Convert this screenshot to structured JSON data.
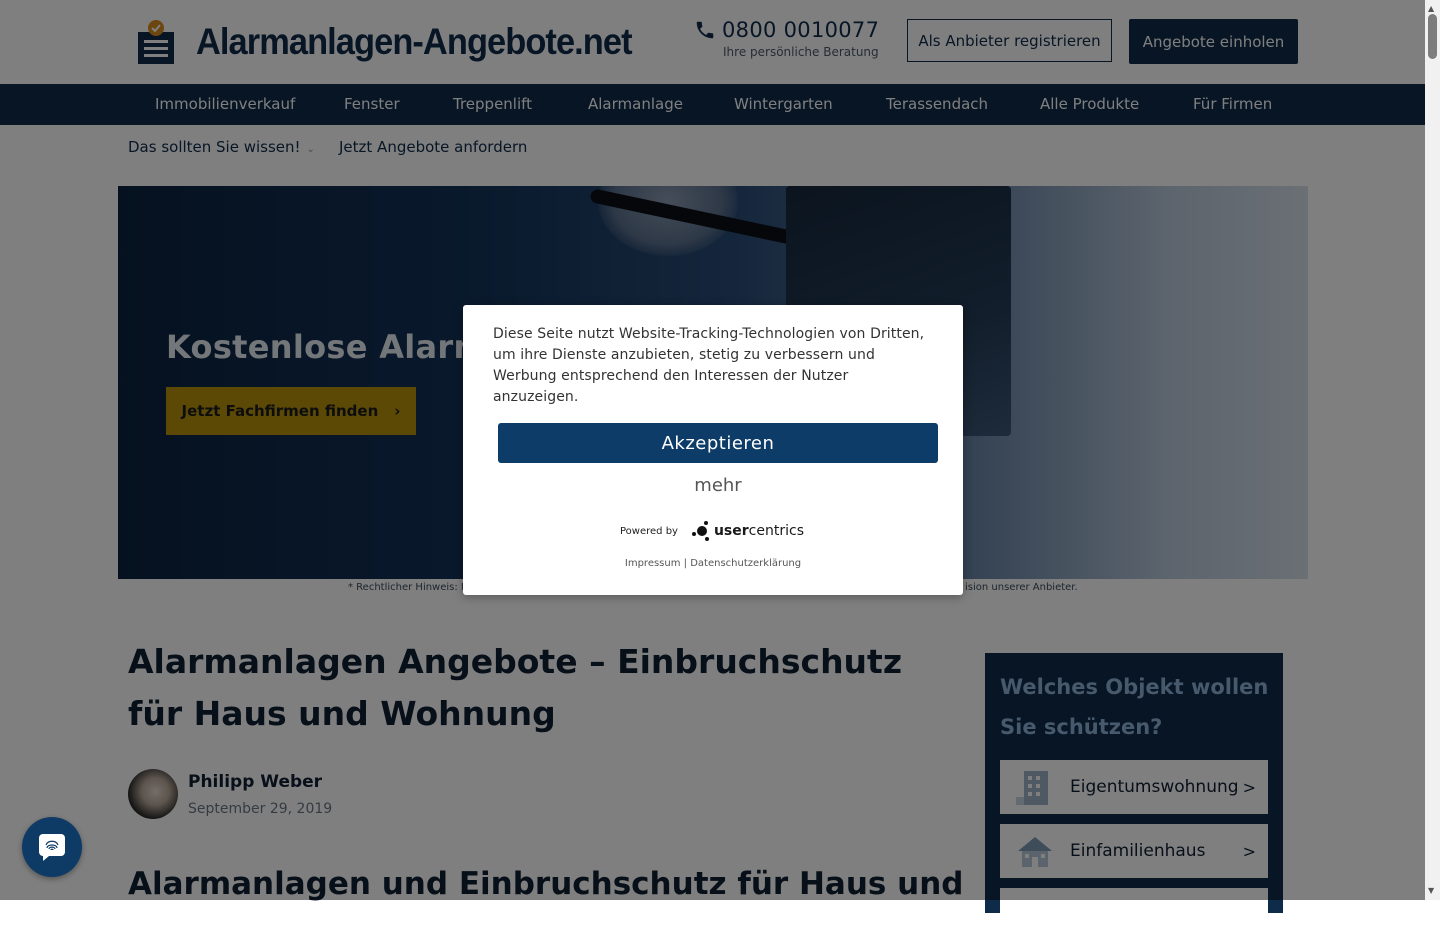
{
  "header": {
    "logo_text": "Alarmanlagen-Angebote.net",
    "phone_number": "0800 0010077",
    "phone_sub": "Ihre persönliche Beratung",
    "register_label": "Als Anbieter registrieren",
    "offers_label": "Angebote einholen"
  },
  "nav": {
    "items": [
      "Immobilienverkauf",
      "Fenster",
      "Treppenlift",
      "Alarmanlage",
      "Wintergarten",
      "Terassendach",
      "Alle Produkte",
      "Für Firmen"
    ]
  },
  "subnav": {
    "items": [
      "Das sollten Sie wissen!",
      "Jetzt Angebote anfordern"
    ]
  },
  "hero": {
    "title": "Kostenlose Alarman",
    "button_label": "Jetzt Fachfirmen finden",
    "button_arrow": "›",
    "legal_left": "* Rechtlicher Hinweis: I",
    "legal_right": "ision unserer Anbieter."
  },
  "article": {
    "title": "Alarmanlagen Angebote – Einbruchschutz für Haus und Wohnung",
    "author_name": "Philipp Weber",
    "author_date": "September 29, 2019",
    "subheading": "Alarmanlagen und Einbruchschutz für Haus und"
  },
  "widget": {
    "title": "Welches Objekt wollen Sie schützen?",
    "options": [
      {
        "label": "Eigentumswohnung",
        "arrow": ">"
      },
      {
        "label": "Einfamilienhaus",
        "arrow": ">"
      }
    ]
  },
  "consent": {
    "text": "Diese Seite nutzt Website-Tracking-Technologien von Dritten, um ihre Dienste anzubieten, stetig zu verbessern und Werbung entsprechend den Interessen der Nutzer anzuzeigen.",
    "accept_label": "Akzeptieren",
    "more_label": "mehr",
    "powered_by": "Powered by",
    "brand_user": "user",
    "brand_centrics": "centrics",
    "impressum": "Impressum",
    "separator": " | ",
    "privacy": "Datenschutzerklärung"
  },
  "colors": {
    "primary": "#0e2b4a",
    "accent": "#b8930c",
    "consent_button": "#0d3c68",
    "widget_title": "#8fb3d9"
  },
  "icons": {
    "logo": "shield-badge-icon",
    "phone": "phone-icon",
    "chat": "fingerprint-chat-icon",
    "apartment": "apartment-building-icon",
    "house": "house-icon"
  }
}
